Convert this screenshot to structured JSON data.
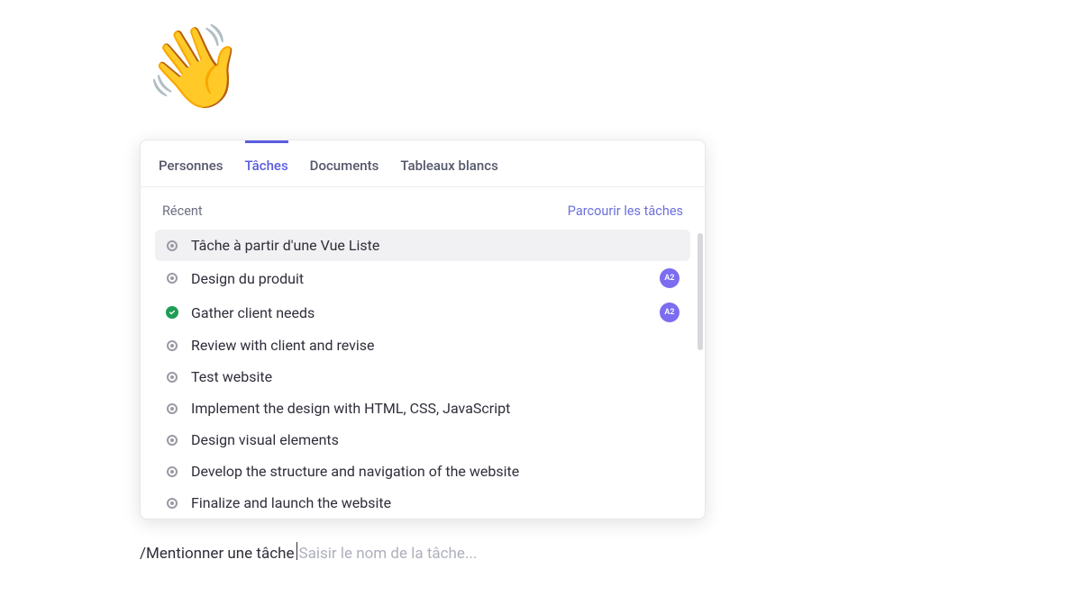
{
  "emoji": "👋",
  "tabs": [
    {
      "label": "Personnes",
      "active": false
    },
    {
      "label": "Tâches",
      "active": true
    },
    {
      "label": "Documents",
      "active": false
    },
    {
      "label": "Tableaux blancs",
      "active": false
    }
  ],
  "section": {
    "label": "Récent",
    "browse": "Parcourir les tâches"
  },
  "tasks": [
    {
      "label": "Tâche à partir d'une Vue Liste",
      "status": "open",
      "highlight": true,
      "avatar": null
    },
    {
      "label": "Design du produit",
      "status": "open",
      "highlight": false,
      "avatar": "A2"
    },
    {
      "label": "Gather client needs",
      "status": "done",
      "highlight": false,
      "avatar": "A2"
    },
    {
      "label": "Review with client and revise",
      "status": "open",
      "highlight": false,
      "avatar": null
    },
    {
      "label": "Test website",
      "status": "open",
      "highlight": false,
      "avatar": null
    },
    {
      "label": "Implement the design with HTML, CSS, JavaScript",
      "status": "open",
      "highlight": false,
      "avatar": null
    },
    {
      "label": "Design visual elements",
      "status": "open",
      "highlight": false,
      "avatar": null
    },
    {
      "label": "Develop the structure and navigation of the website",
      "status": "open",
      "highlight": false,
      "avatar": null
    },
    {
      "label": "Finalize and launch the website",
      "status": "open",
      "highlight": false,
      "avatar": null
    }
  ],
  "mention": {
    "slash": "/",
    "text": "Mentionner une tâche ",
    "placeholder": "Saisir le nom de la tâche..."
  }
}
